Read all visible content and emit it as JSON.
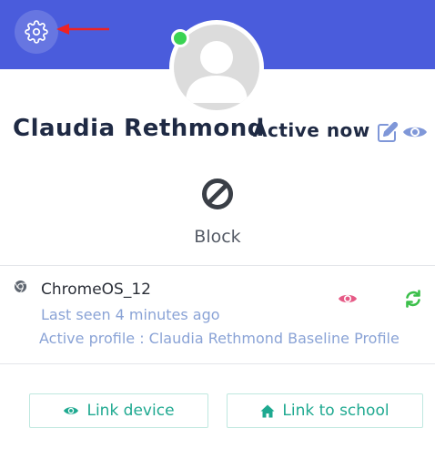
{
  "header": {
    "accent_color": "#4a5cdc",
    "settings_icon": "gear-icon",
    "pointer_icon": "red-arrow-left-icon"
  },
  "profile": {
    "name": "Claudia Rethmond",
    "status": "Active now",
    "online_color": "#39d353",
    "edit_icon": "edit-icon",
    "view_icon": "eye-icon"
  },
  "block": {
    "icon": "ban-icon",
    "label": "Block"
  },
  "device": {
    "icon": "chrome-icon",
    "name": "ChromeOS_12",
    "last_seen": "Last seen 4 minutes ago",
    "active_profile": "Active profile : Claudia Rethmond Baseline Profile",
    "view_icon": "eye-icon",
    "sync_icon": "sync-icon"
  },
  "actions": {
    "link_device": "Link device",
    "link_school": "Link to school",
    "button_color": "#1ea990"
  }
}
